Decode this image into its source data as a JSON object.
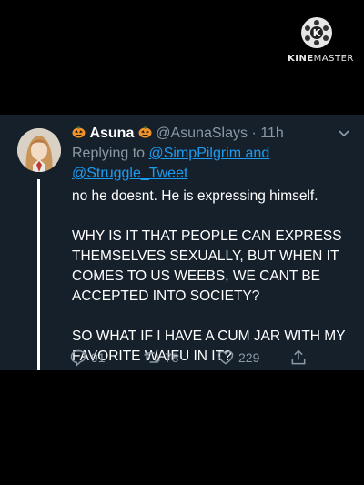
{
  "watermark": {
    "brand_bold": "KINE",
    "brand_rest": "MASTER"
  },
  "tweet": {
    "display_name": "Asuna",
    "handle": "@AsunaSlays",
    "separator": "·",
    "time": "11h",
    "replying_prefix": "Replying to",
    "reply_to_1": "@SimpPilgrim and",
    "reply_to_2": "@Struggle_Tweet",
    "paragraphs": [
      "no he doesnt. He is expressing himself.",
      "WHY IS IT THAT PEOPLE CAN EXPRESS THEMSELVES SEXUALLY, BUT WHEN IT COMES TO US WEEBS, WE CANT BE ACCEPTED INTO SOCIETY?",
      "SO WHAT IF I HAVE A CUM JAR WITH MY FAVORITE WAIFU IN IT?"
    ],
    "reply_count": "91",
    "retweet_count": "78",
    "like_count": "229"
  },
  "colors": {
    "background": "#15202b",
    "link": "#1d9bf0",
    "muted": "#8b98a5"
  },
  "icons": [
    "kinemaster-logo-icon",
    "pumpkin-icon",
    "chevron-down-icon",
    "reply-icon",
    "retweet-icon",
    "heart-icon",
    "share-icon"
  ]
}
